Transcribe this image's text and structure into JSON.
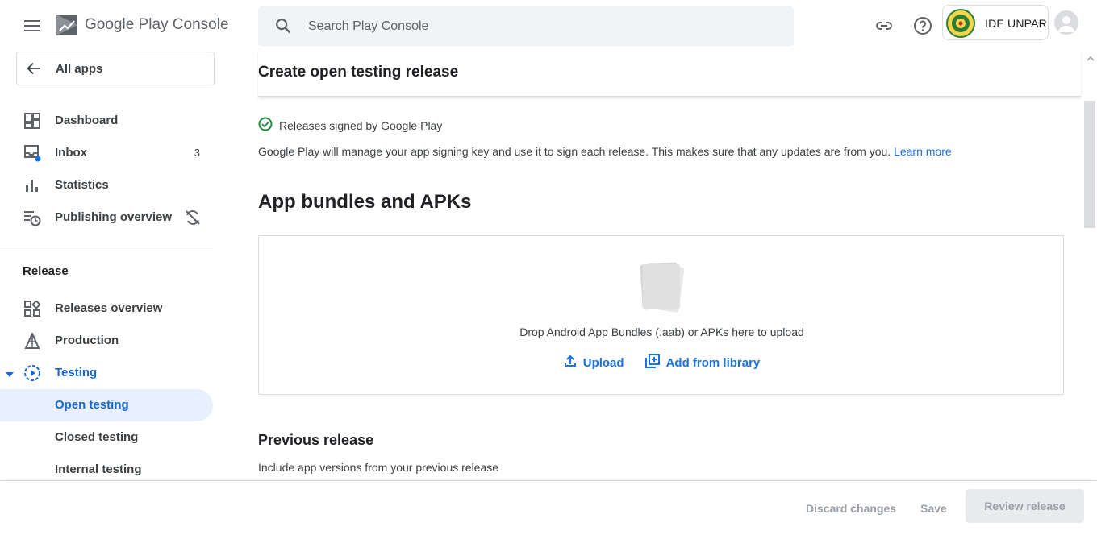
{
  "app": {
    "logo_google_play": "Google Play",
    "logo_console": "Console"
  },
  "search": {
    "placeholder": "Search Play Console"
  },
  "account": {
    "name": "IDE UNPAR"
  },
  "sidebar": {
    "all_apps": "All apps",
    "top_items": [
      {
        "label": "Dashboard",
        "icon": "dashboard-icon"
      },
      {
        "label": "Inbox",
        "icon": "inbox-icon",
        "badge": "3"
      },
      {
        "label": "Statistics",
        "icon": "bar-chart-icon"
      },
      {
        "label": "Publishing overview",
        "icon": "publishing-icon"
      }
    ],
    "release_section": "Release",
    "release_items": [
      {
        "label": "Releases overview",
        "icon": "releases-icon"
      },
      {
        "label": "Production",
        "icon": "production-icon"
      },
      {
        "label": "Testing",
        "icon": "testing-icon"
      },
      {
        "label": "Open testing"
      },
      {
        "label": "Closed testing"
      },
      {
        "label": "Internal testing"
      }
    ]
  },
  "main": {
    "title": "Create open testing release",
    "signing": {
      "label": "Releases signed by Google Play",
      "description": "Google Play will manage your app signing key and use it to sign each release. This makes sure that any updates are from you.",
      "learn_more": "Learn more"
    },
    "bundles": {
      "title": "App bundles and APKs",
      "drop_hint": "Drop Android App Bundles (.aab) or APKs here to upload",
      "upload": "Upload",
      "add_library": "Add from library"
    },
    "previous": {
      "title": "Previous release",
      "description": "Include app versions from your previous release"
    }
  },
  "footer": {
    "discard": "Discard changes",
    "save": "Save",
    "review": "Review release"
  },
  "colors": {
    "accent": "#1a73e8",
    "active_bg": "#e8f0fe",
    "success": "#1e8e3e"
  }
}
